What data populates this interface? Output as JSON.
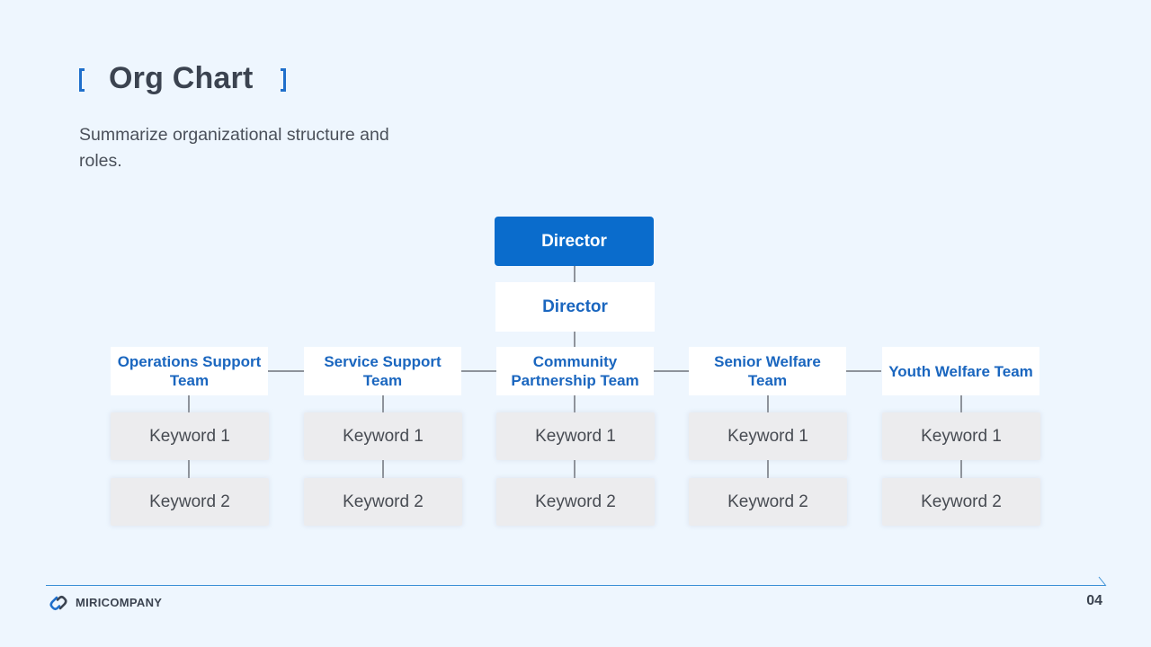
{
  "header": {
    "title": "Org Chart",
    "subtitle": "Summarize organizational structure and roles."
  },
  "org": {
    "top": "Director",
    "sub": "Director",
    "teams": [
      {
        "name": "Operations Support Team",
        "keywords": [
          "Keyword 1",
          "Keyword 2"
        ]
      },
      {
        "name": "Service Support Team",
        "keywords": [
          "Keyword 1",
          "Keyword 2"
        ]
      },
      {
        "name": "Community Partnership Team",
        "keywords": [
          "Keyword 1",
          "Keyword 2"
        ]
      },
      {
        "name": "Senior Welfare Team",
        "keywords": [
          "Keyword 1",
          "Keyword 2"
        ]
      },
      {
        "name": "Youth Welfare Team",
        "keywords": [
          "Keyword 1",
          "Keyword 2"
        ]
      }
    ]
  },
  "footer": {
    "company": "MIRICOMPANY",
    "page_number": "04"
  },
  "colors": {
    "accent": "#0a6ccc",
    "background": "#eef6fe",
    "keyword_fill": "#ececee"
  },
  "icons": {
    "logo": "link-chain-icon"
  }
}
